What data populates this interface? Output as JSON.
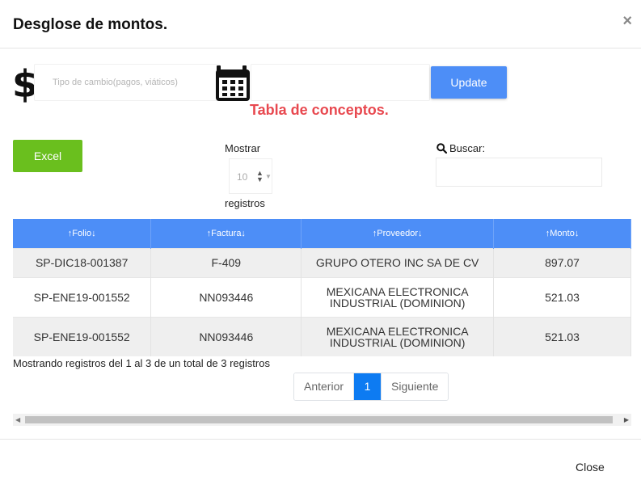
{
  "modal": {
    "title": "Desglose de montos.",
    "close_symbol": "×",
    "close_label": "Close"
  },
  "form": {
    "rate_placeholder": "Tipo de cambio(pagos, viáticos)",
    "rate_value": "",
    "date_value": "",
    "update_label": "Update",
    "dollar_icon": "dollar-icon",
    "calendar_icon": "calendar-icon"
  },
  "table_title": "Tabla de conceptos.",
  "controls": {
    "excel_label": "Excel",
    "show_label": "Mostrar",
    "show_value": "10",
    "records_label": "registros",
    "search_label": "Buscar:",
    "search_value": ""
  },
  "table": {
    "columns": [
      "↑Folio↓",
      "↑Factura↓",
      "↑Proveedor↓",
      "↑Monto↓"
    ],
    "rows": [
      [
        "SP-DIC18-001387",
        "F-409",
        "GRUPO OTERO INC SA DE CV",
        "897.07"
      ],
      [
        "SP-ENE19-001552",
        "NN093446",
        "MEXICANA ELECTRONICA INDUSTRIAL (DOMINION)",
        "521.03"
      ],
      [
        "SP-ENE19-001552",
        "NN093446",
        "MEXICANA ELECTRONICA INDUSTRIAL (DOMINION)",
        "521.03"
      ]
    ]
  },
  "info_text": "Mostrando registros del 1 al 3 de un total de 3 registros",
  "pagination": {
    "prev": "Anterior",
    "current": "1",
    "next": "Siguiente"
  },
  "colors": {
    "primary": "#4d8ef7",
    "excel": "#6abf1e",
    "title_red": "#e8484f",
    "page_active": "#0d7bf2"
  }
}
